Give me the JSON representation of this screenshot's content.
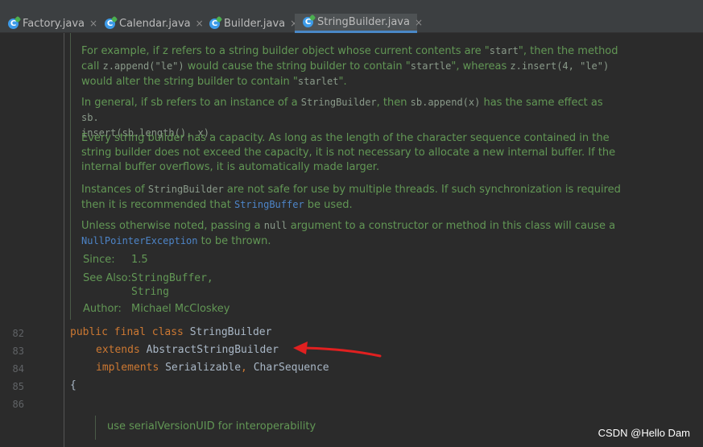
{
  "tabs": [
    {
      "label": "Factory.java",
      "icon": "class-icon",
      "active": false
    },
    {
      "label": "Calendar.java",
      "icon": "class-icon",
      "active": false
    },
    {
      "label": "Builder.java",
      "icon": "class-icon",
      "active": false
    },
    {
      "label": "StringBuilder.java",
      "icon": "class-icon",
      "active": true
    }
  ],
  "close_glyph": "×",
  "doc": {
    "p1": {
      "t1": "For example, if z refers to a string builder object whose current contents are \"",
      "c1": "start",
      "t2": "\", then the method",
      "t3": "call ",
      "c2": "z.append(\"le\")",
      "t4": " would cause the string builder to contain \"",
      "c3": "startle",
      "t5": "\", whereas ",
      "c4": "z.insert(4, \"le\")",
      "t6": "would alter the string builder to contain \"",
      "c5": "starlet",
      "t7": "\"."
    },
    "p2": {
      "t1": "In general, if sb refers to an instance of a ",
      "c1": "StringBuilder",
      "t2": ", then ",
      "c2": "sb.append(x)",
      "t3": " has the same effect as ",
      "c3": "sb.",
      "c4": "insert(sb.length(), x)",
      "t4": "."
    },
    "p3": {
      "l1": "Every string builder has a capacity. As long as the length of the character sequence contained in the",
      "l2": "string builder does not exceed the capacity, it is not necessary to allocate a new internal buffer. If the",
      "l3": "internal buffer overflows, it is automatically made larger."
    },
    "p4": {
      "t1": "Instances of ",
      "c1": "StringBuilder",
      "t2": " are not safe for use by multiple threads. If such synchronization is required",
      "t3": "then it is recommended that ",
      "c2": "StringBuffer",
      "t4": " be used."
    },
    "p5": {
      "t1": "Unless otherwise noted, passing a ",
      "c1": "null",
      "t2": " argument to a constructor or method in this class will cause a",
      "c2": "NullPointerException",
      "t3": " to be thrown."
    },
    "since_label": "Since:",
    "since_value": "1.5",
    "see_also_label": "See Also:",
    "see_also_1": "StringBuffer,",
    "see_also_2": "String",
    "author_label": "Author:",
    "author_value": "Michael McCloskey"
  },
  "code": {
    "line_numbers": [
      "82",
      "83",
      "84",
      "85",
      "86"
    ],
    "l82_kw": "public final class",
    "l82_id": "StringBuilder",
    "l83_kw": "extends",
    "l83_id": "AbstractStringBuilder",
    "l84_kw": "implements",
    "l84_id1": "Serializable",
    "l84_sep": ",",
    "l84_id2": "CharSequence",
    "l85": "{"
  },
  "bottom_doc": "use serialVersionUID for interoperability",
  "watermark": "CSDN @Hello Dam",
  "colors": {
    "arrow": "#e02020",
    "keyword": "#cc7832",
    "doc": "#629755",
    "link": "#4d84c7"
  }
}
